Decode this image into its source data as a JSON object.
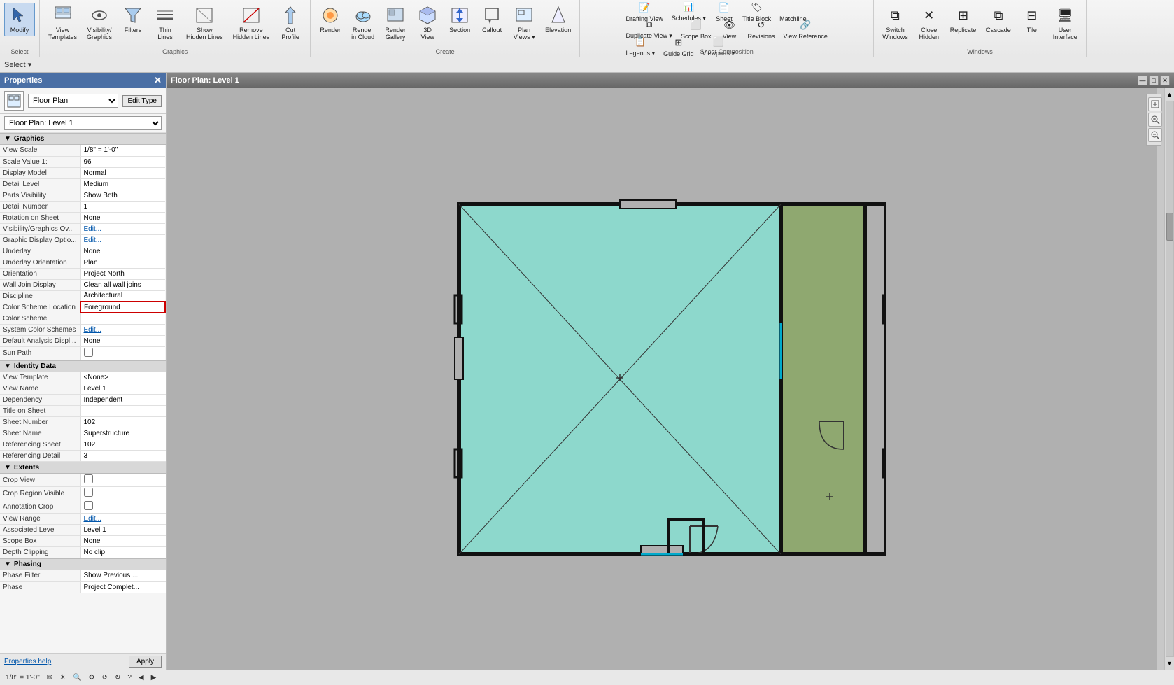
{
  "toolbar": {
    "groups": [
      {
        "name": "select",
        "label": "Select",
        "items": [
          {
            "id": "modify",
            "label": "Modify",
            "icon": "✦",
            "active": true
          }
        ]
      },
      {
        "name": "graphics",
        "label": "Graphics",
        "items": [
          {
            "id": "view-templates",
            "label": "View\nTemplates",
            "icon": "📋"
          },
          {
            "id": "visibility-graphics",
            "label": "Visibility/\nGraphics",
            "icon": "👁"
          },
          {
            "id": "filters",
            "label": "Filters",
            "icon": "⊟"
          },
          {
            "id": "thin-lines",
            "label": "Thin\nLines",
            "icon": "≡"
          },
          {
            "id": "show-hidden-lines",
            "label": "Show\nHidden Lines",
            "icon": "⊞"
          },
          {
            "id": "remove-hidden-lines",
            "label": "Remove\nHidden Lines",
            "icon": "⊠"
          },
          {
            "id": "cut-profile",
            "label": "Cut\nProfile",
            "icon": "✂"
          }
        ]
      },
      {
        "name": "create",
        "label": "Create",
        "items": [
          {
            "id": "render",
            "label": "Render",
            "icon": "🎨"
          },
          {
            "id": "render-cloud",
            "label": "Render\nin Cloud",
            "icon": "☁"
          },
          {
            "id": "render-gallery",
            "label": "Render\nGallery",
            "icon": "🖼"
          },
          {
            "id": "3d-view",
            "label": "3D\nView",
            "icon": "🧊"
          },
          {
            "id": "section",
            "label": "Section",
            "icon": "⊡"
          },
          {
            "id": "callout",
            "label": "Callout",
            "icon": "⬜"
          },
          {
            "id": "plan-views",
            "label": "Plan\nViews",
            "icon": "📐"
          },
          {
            "id": "elevation",
            "label": "Elevation",
            "icon": "↕"
          }
        ]
      },
      {
        "name": "sheet-composition",
        "label": "Sheet Composition",
        "rows": [
          [
            {
              "id": "drafting-view",
              "label": "Drafting View",
              "icon": "📝"
            },
            {
              "id": "schedules",
              "label": "Schedules ▾",
              "icon": "📊"
            },
            {
              "id": "sheet",
              "label": "Sheet",
              "icon": "📄"
            },
            {
              "id": "title-block",
              "label": "Title Block",
              "icon": "🏷"
            },
            {
              "id": "matchline",
              "label": "Matchline",
              "icon": "—"
            }
          ],
          [
            {
              "id": "duplicate-view",
              "label": "Duplicate View ▾",
              "icon": "⧉"
            },
            {
              "id": "scope-box",
              "label": "Scope Box",
              "icon": "⬜"
            },
            {
              "id": "view",
              "label": "View",
              "icon": "👁"
            },
            {
              "id": "revisions",
              "label": "Revisions",
              "icon": "↺"
            },
            {
              "id": "view-reference",
              "label": "View Reference",
              "icon": "🔗"
            }
          ],
          [
            {
              "id": "legends",
              "label": "Legends ▾",
              "icon": "📋"
            },
            {
              "id": "guide-grid",
              "label": "Guide Grid",
              "icon": "⊞"
            },
            {
              "id": "viewports",
              "label": "Viewports ▾",
              "icon": "⬜"
            }
          ]
        ]
      },
      {
        "name": "windows",
        "label": "Windows",
        "items": [
          {
            "id": "switch-windows",
            "label": "Switch\nWindows",
            "icon": "⧉"
          },
          {
            "id": "close-hidden",
            "label": "Close\nHidden",
            "icon": "✕"
          },
          {
            "id": "replicate",
            "label": "Replicate",
            "icon": "⊞"
          },
          {
            "id": "cascade",
            "label": "Cascade",
            "icon": "⧉"
          },
          {
            "id": "tile",
            "label": "Tile",
            "icon": "⊟"
          },
          {
            "id": "user-interface",
            "label": "User\nInterface",
            "icon": "🖥"
          }
        ]
      }
    ]
  },
  "select_bar": {
    "label": "Select ▾"
  },
  "properties": {
    "title": "Properties",
    "type_name": "Floor Plan",
    "level": "Floor Plan: Level 1",
    "edit_type_label": "Edit Type",
    "sections": [
      {
        "name": "Graphics",
        "collapsed": false,
        "rows": [
          {
            "label": "View Scale",
            "value": "1/8\" = 1'-0\"",
            "type": "text"
          },
          {
            "label": "Scale Value  1:",
            "value": "96",
            "type": "text"
          },
          {
            "label": "Display Model",
            "value": "Normal",
            "type": "text"
          },
          {
            "label": "Detail Level",
            "value": "Medium",
            "type": "text"
          },
          {
            "label": "Parts Visibility",
            "value": "Show Both",
            "type": "text"
          },
          {
            "label": "Detail Number",
            "value": "1",
            "type": "text"
          },
          {
            "label": "Rotation on Sheet",
            "value": "None",
            "type": "text"
          },
          {
            "label": "Visibility/Graphics Ov...",
            "value": "Edit...",
            "type": "link"
          },
          {
            "label": "Graphic Display Optio...",
            "value": "Edit...",
            "type": "link"
          },
          {
            "label": "Underlay",
            "value": "None",
            "type": "text"
          },
          {
            "label": "Underlay Orientation",
            "value": "Plan",
            "type": "text"
          },
          {
            "label": "Orientation",
            "value": "Project North",
            "type": "text"
          },
          {
            "label": "Wall Join Display",
            "value": "Clean all wall joins",
            "type": "text"
          },
          {
            "label": "Discipline",
            "value": "Architectural",
            "type": "text"
          },
          {
            "label": "Color Scheme Location",
            "value": "Foreground",
            "type": "highlight"
          },
          {
            "label": "Color Scheme",
            "value": "",
            "type": "text"
          },
          {
            "label": "System Color Schemes",
            "value": "Edit...",
            "type": "link"
          },
          {
            "label": "Default Analysis Displ...",
            "value": "None",
            "type": "text"
          },
          {
            "label": "Sun Path",
            "value": "",
            "type": "checkbox"
          }
        ]
      },
      {
        "name": "Identity Data",
        "collapsed": false,
        "rows": [
          {
            "label": "View Template",
            "value": "<None>",
            "type": "text"
          },
          {
            "label": "View Name",
            "value": "Level 1",
            "type": "text"
          },
          {
            "label": "Dependency",
            "value": "Independent",
            "type": "text"
          },
          {
            "label": "Title on Sheet",
            "value": "",
            "type": "text"
          },
          {
            "label": "Sheet Number",
            "value": "102",
            "type": "text"
          },
          {
            "label": "Sheet Name",
            "value": "Superstructure",
            "type": "text"
          },
          {
            "label": "Referencing Sheet",
            "value": "102",
            "type": "text"
          },
          {
            "label": "Referencing Detail",
            "value": "3",
            "type": "text"
          }
        ]
      },
      {
        "name": "Extents",
        "collapsed": false,
        "rows": [
          {
            "label": "Crop View",
            "value": "",
            "type": "checkbox"
          },
          {
            "label": "Crop Region Visible",
            "value": "",
            "type": "checkbox"
          },
          {
            "label": "Annotation Crop",
            "value": "",
            "type": "checkbox"
          },
          {
            "label": "View Range",
            "value": "Edit...",
            "type": "link"
          },
          {
            "label": "Associated Level",
            "value": "Level 1",
            "type": "text"
          },
          {
            "label": "Scope Box",
            "value": "None",
            "type": "text"
          },
          {
            "label": "Depth Clipping",
            "value": "No clip",
            "type": "text"
          }
        ]
      },
      {
        "name": "Phasing",
        "collapsed": false,
        "rows": [
          {
            "label": "Phase Filter",
            "value": "Show Previous ...",
            "type": "text"
          },
          {
            "label": "Phase",
            "value": "Project Complet...",
            "type": "text"
          }
        ]
      }
    ],
    "footer": {
      "help_link": "Properties help",
      "apply_btn": "Apply"
    }
  },
  "view": {
    "title": "Floor Plan: Level 1",
    "window_min": "—",
    "window_max": "□",
    "window_close": "✕"
  },
  "status_bar": {
    "scale": "1/8\" = 1'-0\"",
    "icons": [
      "✉",
      "☀",
      "🔍",
      "⚙",
      "↺",
      "↻",
      "?",
      "◀",
      "▶"
    ]
  },
  "floor_plan": {
    "bg_color": "#8dd8cc",
    "side_room_color": "#8fa870",
    "outer_border": "#222",
    "inner_lines": "#333"
  }
}
